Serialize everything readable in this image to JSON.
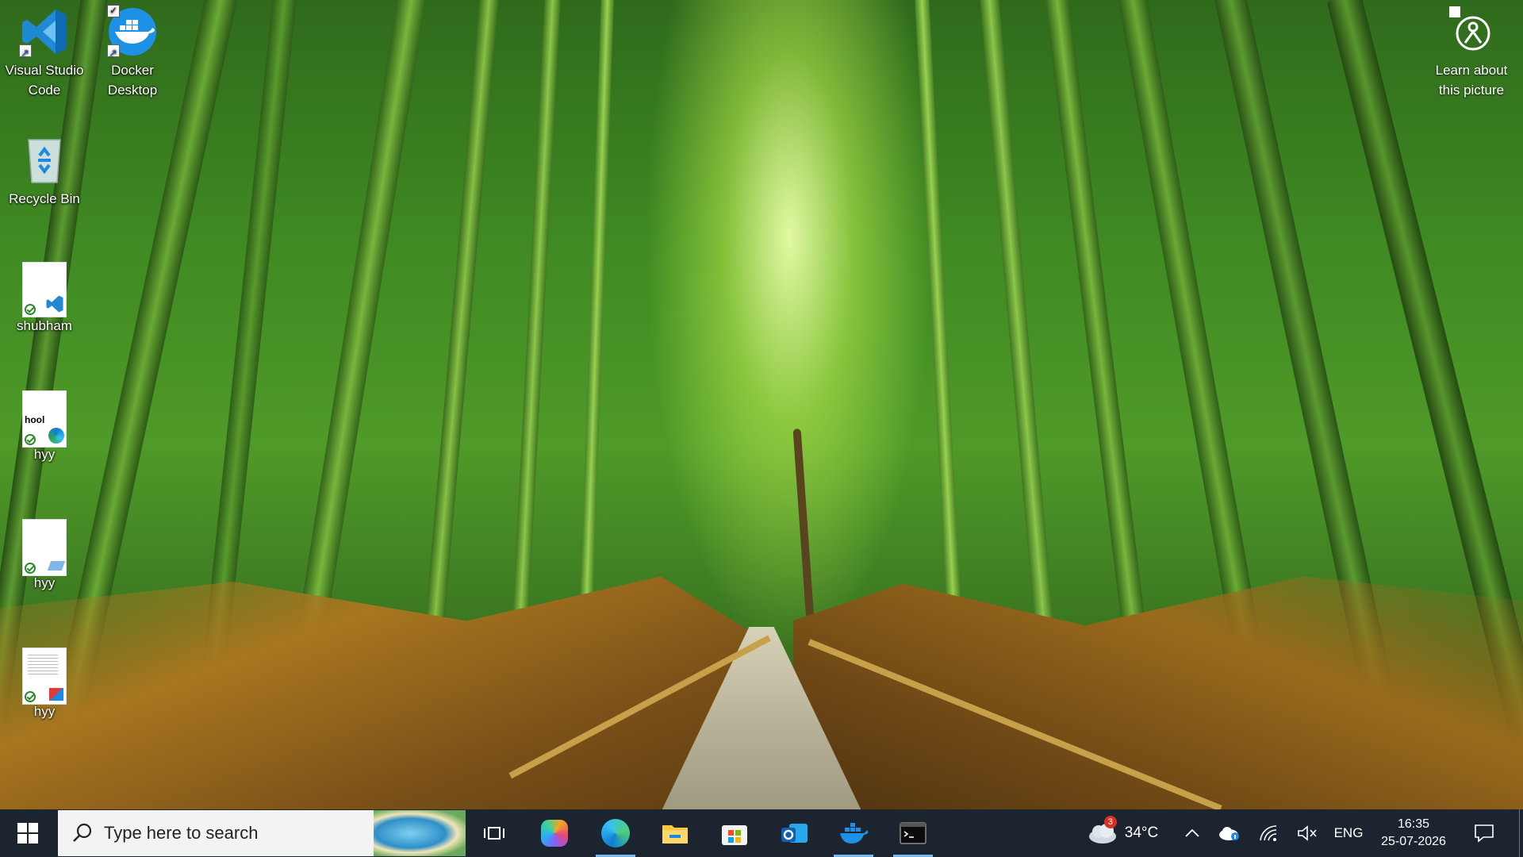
{
  "desktop": {
    "icons": [
      {
        "label_line1": "Visual Studio",
        "label_line2": "Code",
        "icon": "vscode-icon"
      },
      {
        "label_line1": "Docker",
        "label_line2": "Desktop",
        "icon": "docker-icon"
      },
      {
        "label_line1": "Recycle Bin",
        "label_line2": "",
        "icon": "recycle-bin-icon"
      },
      {
        "label_line1": "shubham",
        "label_line2": "",
        "icon": "document-vscode-icon"
      },
      {
        "label_line1": "hyy",
        "label_line2": "",
        "icon": "document-edge-icon"
      },
      {
        "label_line1": "hyy",
        "label_line2": "",
        "icon": "document-icon"
      },
      {
        "label_line1": "hyy",
        "label_line2": "",
        "icon": "document-paint-icon"
      }
    ],
    "hyy_thumb_text": "hool",
    "learn_about": {
      "line1": "Learn about",
      "line2": "this picture",
      "icon": "camera-info-icon"
    }
  },
  "taskbar": {
    "search_placeholder": "Type here to search",
    "pinned": [
      "task-view-icon",
      "copilot-icon",
      "edge-icon",
      "file-explorer-icon",
      "microsoft-store-icon",
      "outlook-icon",
      "docker-icon",
      "terminal-icon"
    ],
    "weather": {
      "temperature": "34°C",
      "badge": "3"
    },
    "language": "ENG",
    "time": "16:35",
    "date": "25-07-2026"
  },
  "colors": {
    "taskbar_bg": "#1c2430",
    "accent": "#76b9ed",
    "vscode_blue": "#1f8ad2",
    "docker_blue": "#1d91e6"
  }
}
